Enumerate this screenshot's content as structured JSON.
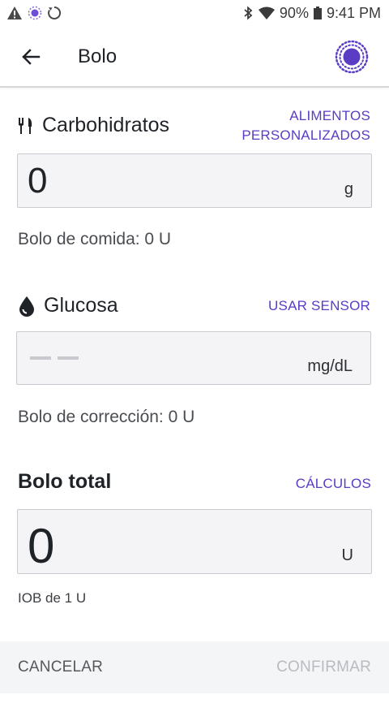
{
  "status_bar": {
    "left_icons": [
      "alert-icon",
      "sync-icon",
      "loop-icon"
    ],
    "right_icons": [
      "bluetooth-icon",
      "wifi-icon",
      "battery-icon"
    ],
    "battery": "90%",
    "time": "9:41 PM"
  },
  "app_bar": {
    "title": "Bolo",
    "back_icon": "arrow-left-icon",
    "pod_icon": "pod-status-icon",
    "accent": "#5b3cc4"
  },
  "carbs": {
    "title": "Carbohidratos",
    "icon": "fork-knife-icon",
    "link_line1": "ALIMENTOS",
    "link_line2": "PERSONALIZADOS",
    "value": "0",
    "unit": "g",
    "helper": "Bolo de comida: 0 U"
  },
  "glucose": {
    "title": "Glucosa",
    "icon": "drop-icon",
    "link": "USAR SENSOR",
    "value": "",
    "unit": "mg/dL",
    "helper": "Bolo de corrección: 0 U"
  },
  "total": {
    "title": "Bolo total",
    "link": "CÁLCULOS",
    "value": "0",
    "unit": "U",
    "helper": "IOB de 1 U"
  },
  "actions": {
    "cancel": "CANCELAR",
    "confirm": "CONFIRMAR"
  },
  "colors": {
    "accent": "#5b3cc4",
    "field_bg": "#f4f4f6",
    "disabled_text": "#b8bbbf"
  }
}
